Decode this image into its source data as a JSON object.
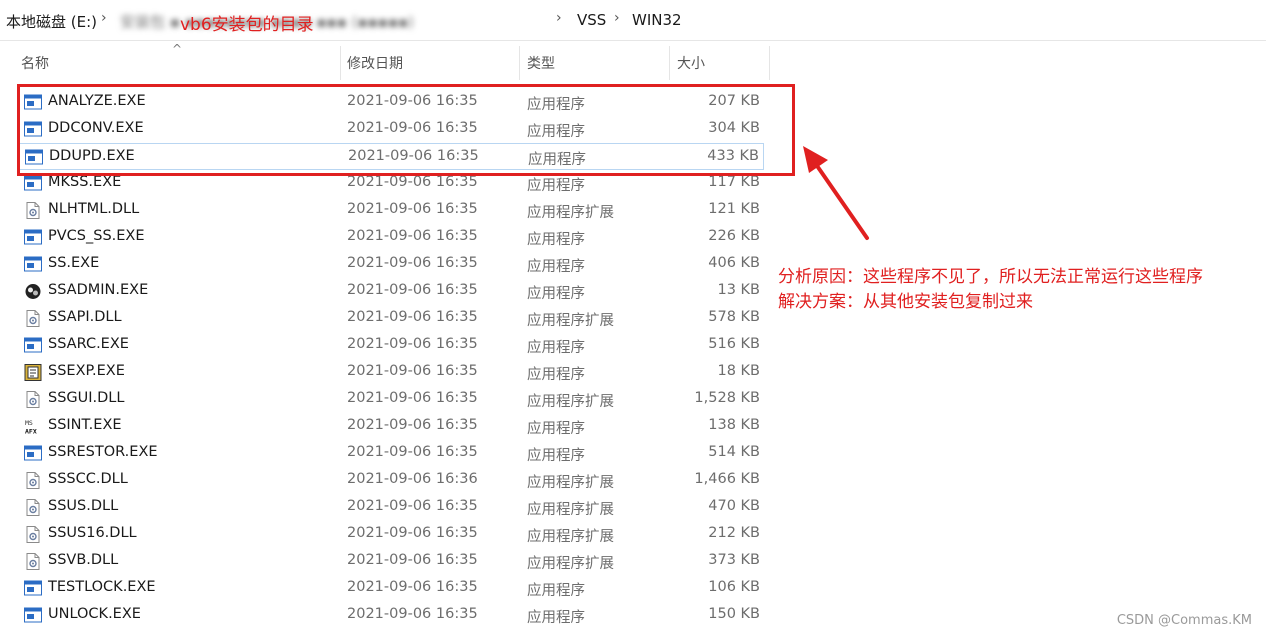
{
  "breadcrumb": {
    "drive": "本地磁盘 (E:)",
    "blurred_path": "安装包 ▪ ▪▪▪▪▪▪▪▪ ▪▪▪▪ ▪▪▪ (▪▪▪▪▪)",
    "annotation": "vb6安装包的目录",
    "folder1": "VSS",
    "folder2": "WIN32",
    "separator": "›"
  },
  "columns": {
    "name": "名称",
    "date": "修改日期",
    "type": "类型",
    "size": "大小"
  },
  "files": [
    {
      "name": "ANALYZE.EXE",
      "date": "2021-09-06 16:35",
      "type": "应用程序",
      "size": "207 KB",
      "icon": "exe-window-icon"
    },
    {
      "name": "DDCONV.EXE",
      "date": "2021-09-06 16:35",
      "type": "应用程序",
      "size": "304 KB",
      "icon": "exe-window-icon"
    },
    {
      "name": "DDUPD.EXE",
      "date": "2021-09-06 16:35",
      "type": "应用程序",
      "size": "433 KB",
      "icon": "exe-window-icon"
    },
    {
      "name": "MKSS.EXE",
      "date": "2021-09-06 16:35",
      "type": "应用程序",
      "size": "117 KB",
      "icon": "exe-window-icon"
    },
    {
      "name": "NLHTML.DLL",
      "date": "2021-09-06 16:35",
      "type": "应用程序扩展",
      "size": "121 KB",
      "icon": "dll-gear-icon"
    },
    {
      "name": "PVCS_SS.EXE",
      "date": "2021-09-06 16:35",
      "type": "应用程序",
      "size": "226 KB",
      "icon": "exe-window-icon"
    },
    {
      "name": "SS.EXE",
      "date": "2021-09-06 16:35",
      "type": "应用程序",
      "size": "406 KB",
      "icon": "exe-window-icon"
    },
    {
      "name": "SSADMIN.EXE",
      "date": "2021-09-06 16:35",
      "type": "应用程序",
      "size": "13 KB",
      "icon": "ssadmin-icon"
    },
    {
      "name": "SSAPI.DLL",
      "date": "2021-09-06 16:35",
      "type": "应用程序扩展",
      "size": "578 KB",
      "icon": "dll-gear-icon"
    },
    {
      "name": "SSARC.EXE",
      "date": "2021-09-06 16:35",
      "type": "应用程序",
      "size": "516 KB",
      "icon": "exe-window-icon"
    },
    {
      "name": "SSEXP.EXE",
      "date": "2021-09-06 16:35",
      "type": "应用程序",
      "size": "18 KB",
      "icon": "ssexp-icon"
    },
    {
      "name": "SSGUI.DLL",
      "date": "2021-09-06 16:35",
      "type": "应用程序扩展",
      "size": "1,528 KB",
      "icon": "dll-gear-icon"
    },
    {
      "name": "SSINT.EXE",
      "date": "2021-09-06 16:35",
      "type": "应用程序",
      "size": "138 KB",
      "icon": "ms-afx-icon"
    },
    {
      "name": "SSRESTOR.EXE",
      "date": "2021-09-06 16:35",
      "type": "应用程序",
      "size": "514 KB",
      "icon": "exe-window-icon"
    },
    {
      "name": "SSSCC.DLL",
      "date": "2021-09-06 16:36",
      "type": "应用程序扩展",
      "size": "1,466 KB",
      "icon": "dll-gear-icon"
    },
    {
      "name": "SSUS.DLL",
      "date": "2021-09-06 16:35",
      "type": "应用程序扩展",
      "size": "470 KB",
      "icon": "dll-gear-icon"
    },
    {
      "name": "SSUS16.DLL",
      "date": "2021-09-06 16:35",
      "type": "应用程序扩展",
      "size": "212 KB",
      "icon": "dll-gear-icon"
    },
    {
      "name": "SSVB.DLL",
      "date": "2021-09-06 16:35",
      "type": "应用程序扩展",
      "size": "373 KB",
      "icon": "dll-gear-icon"
    },
    {
      "name": "TESTLOCK.EXE",
      "date": "2021-09-06 16:35",
      "type": "应用程序",
      "size": "106 KB",
      "icon": "exe-window-icon"
    },
    {
      "name": "UNLOCK.EXE",
      "date": "2021-09-06 16:35",
      "type": "应用程序",
      "size": "150 KB",
      "icon": "exe-window-icon"
    }
  ],
  "selected_index": 2,
  "annotations": {
    "note_line1": "分析原因：这些程序不见了，所以无法正常运行这些程序",
    "note_line2": "解决方案：从其他安装包复制过来"
  },
  "watermark": "CSDN @Commas.KM",
  "colors": {
    "annotation_red": "#e02020",
    "selection_border": "#b9d6f2",
    "exe_icon_blue": "#2b6cc4"
  }
}
